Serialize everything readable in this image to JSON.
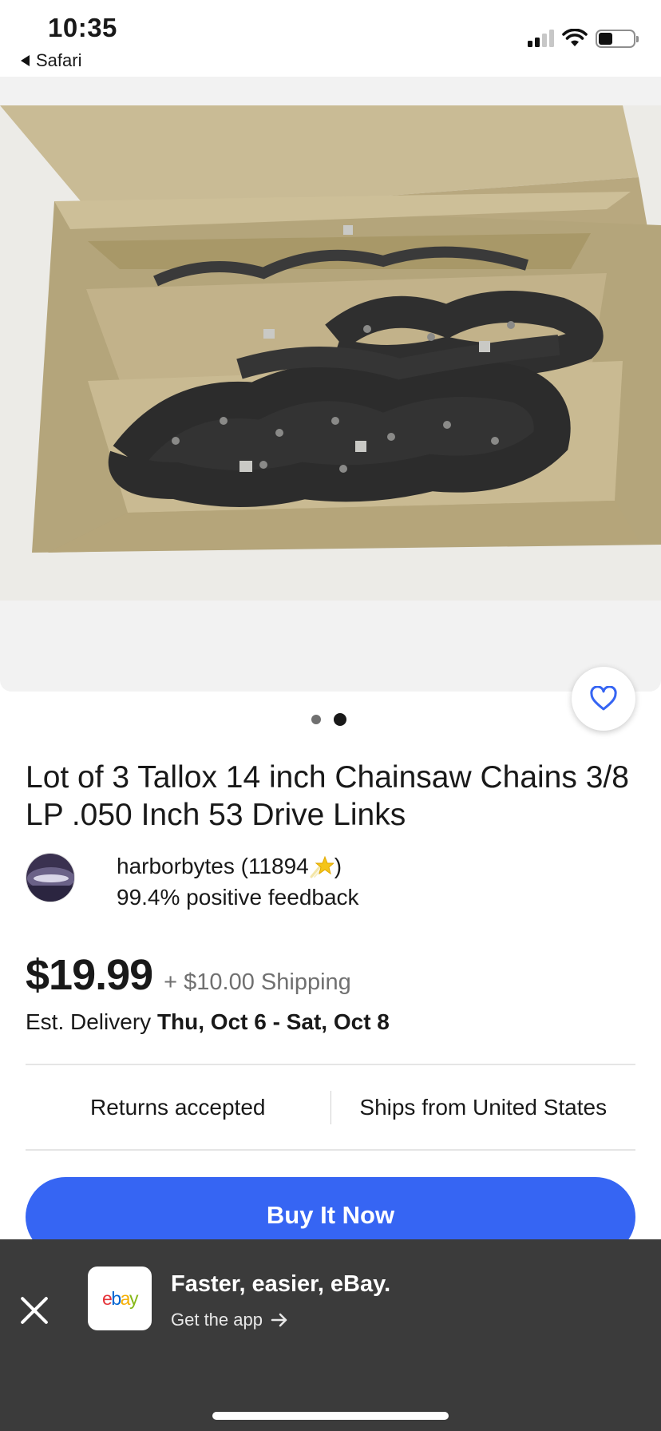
{
  "status_bar": {
    "time": "10:35",
    "back_label": "Safari",
    "icons": [
      "cellular-signal-icon",
      "wifi-icon",
      "battery-icon"
    ],
    "battery_level": 0.4
  },
  "gallery": {
    "image_alt": "Three chainsaw chains in a cardboard box",
    "image_count": 2,
    "active_index": 1,
    "favorite_icon": "heart-outline-icon"
  },
  "listing": {
    "title": "Lot of 3 Tallox 14 inch Chainsaw Chains 3/8 LP .050 Inch 53 Drive Links",
    "seller": {
      "name_prefix": "harborbytes (11894",
      "name_suffix": ")",
      "badge_icon": "shooting-star-icon",
      "feedback": "99.4% positive feedback"
    },
    "price": "$19.99",
    "shipping": "+ $10.00 Shipping",
    "delivery_label": "Est. Delivery",
    "delivery_dates": "Thu, Oct 6 - Sat, Oct 8",
    "policies": [
      "Returns accepted",
      "Ships from United States"
    ],
    "buy_label": "Buy It Now"
  },
  "app_banner": {
    "title": "Faster, easier, eBay.",
    "cta": "Get the app",
    "logo_letters": [
      "e",
      "b",
      "a",
      "y"
    ],
    "logo_colors": [
      "#e53238",
      "#0064d2",
      "#f5af02",
      "#86b817"
    ]
  },
  "colors": {
    "accent": "#3665f3",
    "banner_bg": "#3b3b3b"
  }
}
